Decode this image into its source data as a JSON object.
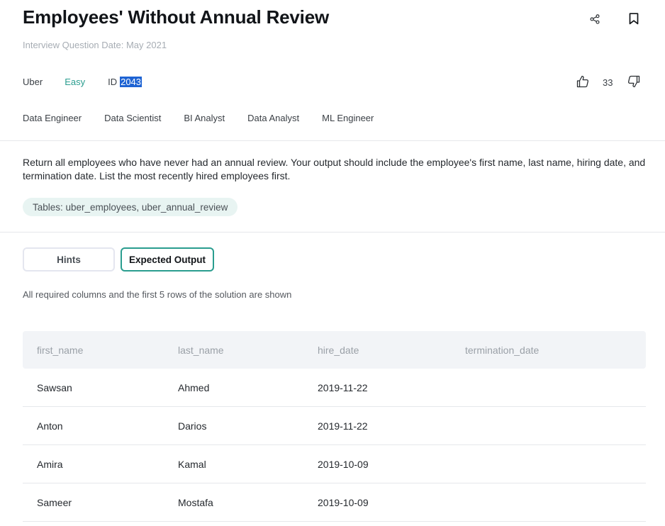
{
  "question": {
    "title": "Employees' Without Annual Review",
    "date_label": "Interview Question Date: May 2021",
    "company": "Uber",
    "difficulty": "Easy",
    "id_label": "ID",
    "id_value": "2043",
    "votes": "33",
    "roles": [
      "Data Engineer",
      "Data Scientist",
      "BI Analyst",
      "Data Analyst",
      "ML Engineer"
    ],
    "description": "Return all employees who have never had an annual review. Your output should include the employee's first name, last name, hiring date, and termination date. List the most recently hired employees first.",
    "tables_label": "Tables: uber_employees, uber_annual_review"
  },
  "tabs": {
    "hints": "Hints",
    "expected_output": "Expected Output"
  },
  "output": {
    "note": "All required columns and the first 5 rows of the solution are shown",
    "columns": [
      "first_name",
      "last_name",
      "hire_date",
      "termination_date"
    ],
    "rows": [
      [
        "Sawsan",
        "Ahmed",
        "2019-11-22",
        ""
      ],
      [
        "Anton",
        "Darios",
        "2019-11-22",
        ""
      ],
      [
        "Amira",
        "Kamal",
        "2019-10-09",
        ""
      ],
      [
        "Sameer",
        "Mostafa",
        "2019-10-09",
        ""
      ]
    ]
  },
  "colors": {
    "accent": "#2a9d8f",
    "selection": "#1e63d3",
    "pill_bg": "#e8f4f2",
    "header_bg": "#f2f4f7"
  },
  "icons": [
    "share-icon",
    "bookmark-icon",
    "thumbs-up-icon",
    "thumbs-down-icon"
  ]
}
